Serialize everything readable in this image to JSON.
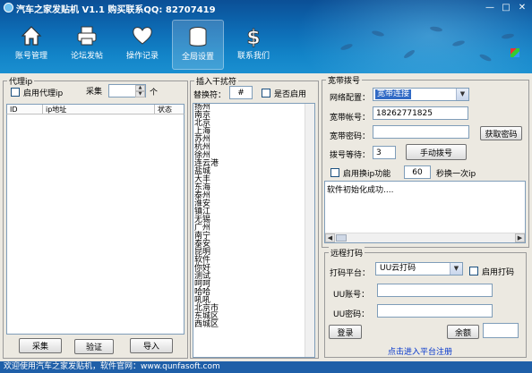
{
  "window": {
    "title": "汽车之家发贴机  V1.1  购买联系QQ: 82707419",
    "minimize": "—",
    "maximize": "□",
    "close": "✕"
  },
  "toolbar": [
    {
      "label": "账号管理",
      "icon": "home-icon"
    },
    {
      "label": "论坛发帖",
      "icon": "printer-icon"
    },
    {
      "label": "操作记录",
      "icon": "heart-icon"
    },
    {
      "label": "全局设置",
      "icon": "database-icon"
    },
    {
      "label": "联系我们",
      "icon": "dollar-icon"
    }
  ],
  "proxy": {
    "title": "代理ip",
    "enable_label": "启用代理ip",
    "collect_label": "采集",
    "count_value": "",
    "count_unit": "个",
    "columns": [
      "ID",
      "ip地址",
      "状态"
    ],
    "btn_collect": "采集",
    "btn_verify": "验证",
    "btn_import": "导入"
  },
  "insert": {
    "title": "插入干扰符",
    "replace_label": "替换符：",
    "replace_value": "#",
    "enable_label": "是否启用",
    "items": [
      "扬州",
      "南京",
      "北京",
      "上海",
      "苏州",
      "杭州",
      "徐州",
      "连云港",
      "盐城",
      "大丰",
      "东海",
      "泰州",
      "淮安",
      "镇江",
      "无锡",
      "广州",
      "南宁",
      "泰安",
      "昆明",
      "软件",
      "你好",
      "测试",
      "呵呵",
      "哈哈",
      "吼吼",
      "北京市",
      "东城区",
      "西城区"
    ]
  },
  "broadband": {
    "title": "宽带拨号",
    "config_label": "网络配置：",
    "config_value": "宽带连接",
    "account_label": "宽带帐号：",
    "account_value": "18262771825",
    "password_label": "宽带密码：",
    "password_value": "",
    "get_password": "获取密码",
    "wait_label": "拨号等待：",
    "wait_value": "3",
    "manual_dial": "手动拨号",
    "ip_switch_label": "启用换ip功能",
    "ip_switch_value": "60",
    "ip_switch_suffix": "秒换一次ip",
    "log": "软件初始化成功...."
  },
  "remote": {
    "title": "远程打码",
    "platform_label": "打码平台：",
    "platform_value": "UU云打码",
    "enable_label": "启用打码",
    "uu_account_label": "UU账号：",
    "uu_account_value": "",
    "uu_password_label": "UU密码：",
    "uu_password_value": "",
    "login": "登录",
    "balance": "余额",
    "balance_value": "",
    "register_link": "点击进入平台注册"
  },
  "status": {
    "text": "欢迎使用汽车之家发贴机，软件官网：www.qunfasoft.com"
  }
}
